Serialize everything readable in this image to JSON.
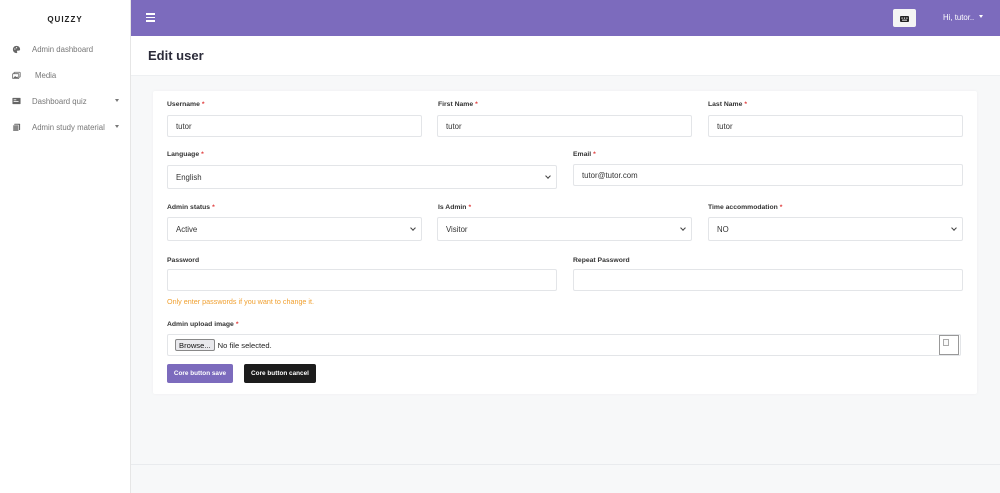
{
  "brand": "QUIZZY",
  "sidebar": {
    "items": [
      {
        "label": "Admin dashboard",
        "icon": "palette-icon",
        "has_caret": false
      },
      {
        "label": "Media",
        "icon": "images-icon",
        "has_caret": false
      },
      {
        "label": "Dashboard quiz",
        "icon": "card-icon",
        "has_caret": true
      },
      {
        "label": "Admin study material",
        "icon": "book-icon",
        "has_caret": true
      }
    ]
  },
  "topbar": {
    "menu_icon": "hamburger-icon",
    "lang_icon": "keyboard-icon",
    "user_greeting": "Hi, tutor.."
  },
  "page": {
    "title": "Edit user"
  },
  "form": {
    "username": {
      "label": "Username",
      "value": "tutor",
      "required": true
    },
    "first_name": {
      "label": "First Name",
      "value": "tutor",
      "required": true
    },
    "last_name": {
      "label": "Last Name",
      "value": "tutor",
      "required": true
    },
    "language": {
      "label": "Language",
      "value": "English",
      "required": true
    },
    "email": {
      "label": "Email",
      "value": "tutor@tutor.com",
      "required": true
    },
    "admin_status": {
      "label": "Admin status",
      "value": "Active",
      "required": true
    },
    "is_admin": {
      "label": "Is Admin",
      "value": "Visitor",
      "required": true
    },
    "time_accommodation": {
      "label": "Time accommodation",
      "value": "NO",
      "required": true
    },
    "password": {
      "label": "Password",
      "value": ""
    },
    "repeat_password": {
      "label": "Repeat Password",
      "value": ""
    },
    "password_help": "Only enter passwords if you want to change it.",
    "upload": {
      "label": "Admin upload image",
      "required": true,
      "browse_label": "Browse...",
      "status": "No file selected."
    },
    "save_label": "Core button save",
    "cancel_label": "Core button cancel"
  },
  "colors": {
    "accent": "#7c6bbd",
    "required": "#e03a3a",
    "help": "#f0a030",
    "cancel": "#1c1c1c"
  }
}
